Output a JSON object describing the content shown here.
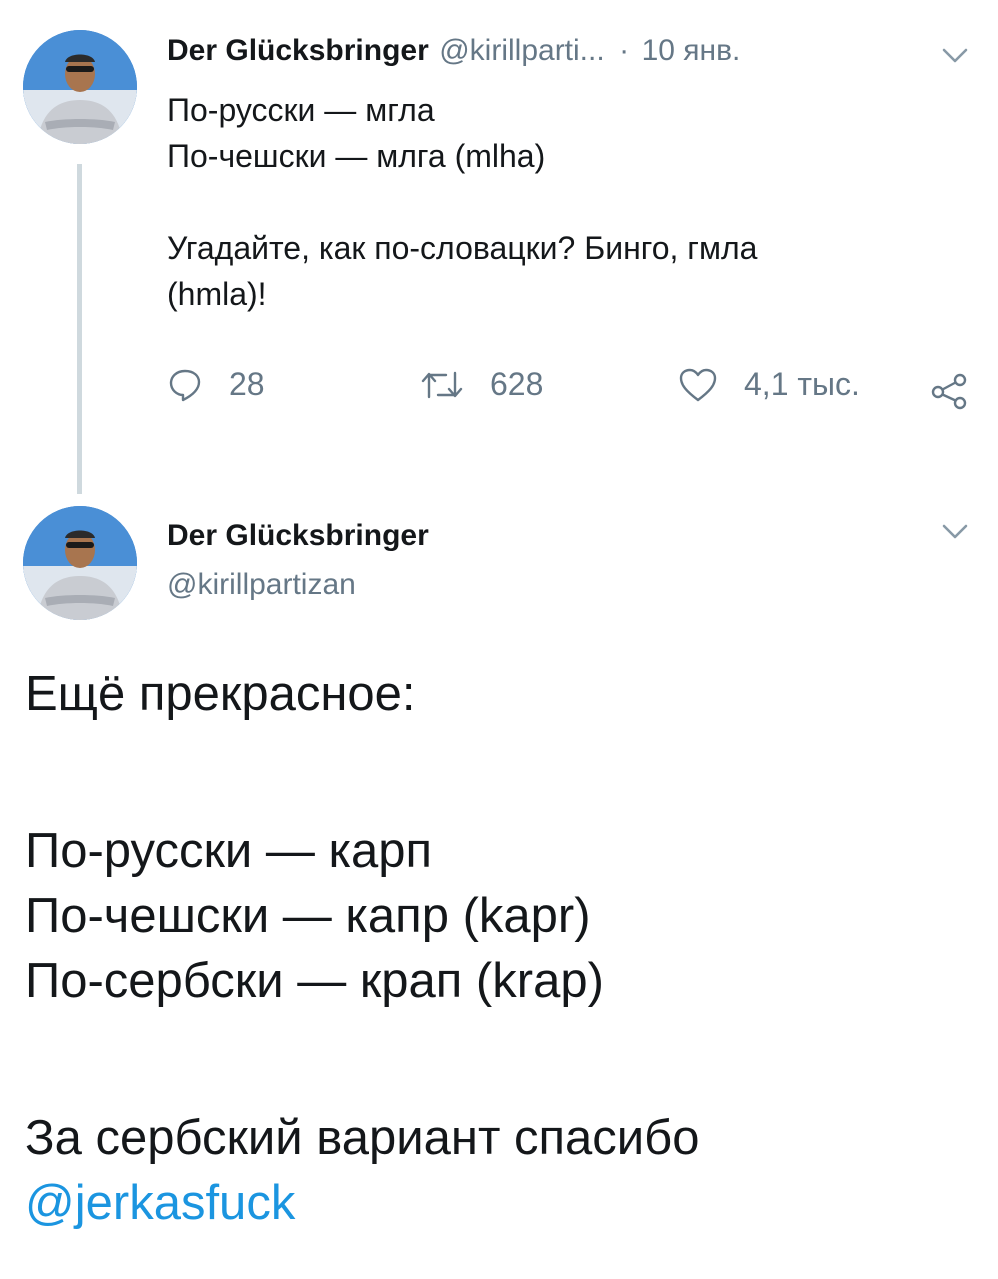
{
  "tweet1": {
    "author_name": "Der Glücksbringer",
    "author_handle": "@kirillparti...",
    "separator": "·",
    "date": "10 янв.",
    "lines": [
      "По-русски — мгла",
      "По-чешски — млга (mlha)",
      "",
      "Угадайте, как по-словацки? Бинго, гмла",
      "(hmla)!"
    ],
    "actions": {
      "reply_count": "28",
      "retweet_count": "628",
      "like_count": "4,1 тыс."
    }
  },
  "tweet2": {
    "author_name": "Der Glücksbringer",
    "author_handle": "@kirillpartizan",
    "lines": [
      "Ещё прекрасное:",
      "",
      "По-русски — карп",
      "По-чешски — капр (kapr)",
      "По-сербски — крап (krap)",
      "",
      "За сербский вариант спасибо"
    ],
    "mention": "@jerkasfuck"
  },
  "icons": {
    "reply": "reply-icon",
    "retweet": "retweet-icon",
    "like": "heart-icon",
    "share": "share-icon",
    "menu": "chevron-down-icon"
  },
  "colors": {
    "text": "#14171a",
    "secondary": "#657786",
    "link": "#1b95e0",
    "thread_line": "#cfd9de"
  }
}
